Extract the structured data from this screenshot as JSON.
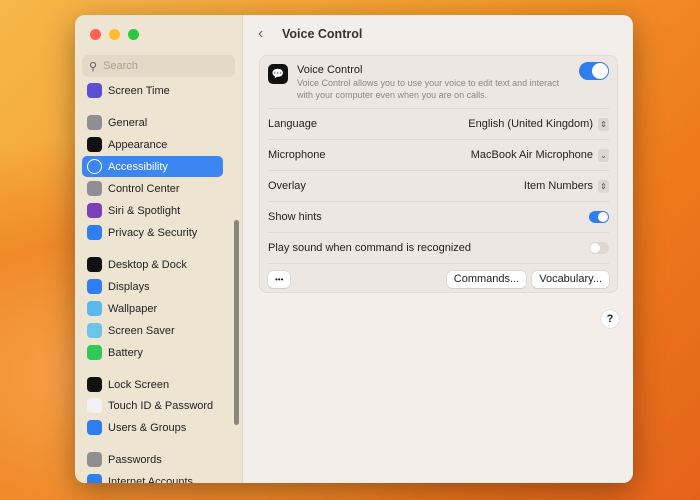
{
  "sidebar": {
    "search_placeholder": "Search",
    "items": [
      {
        "label": "Screen Time",
        "color": "#5b4fd6"
      },
      {
        "label": "General",
        "color": "#8e8e93"
      },
      {
        "label": "Appearance",
        "color": "#111111"
      },
      {
        "label": "Accessibility",
        "color": "#2f7ef0",
        "selected": true
      },
      {
        "label": "Control Center",
        "color": "#8e8e93"
      },
      {
        "label": "Siri & Spotlight",
        "color": "#7b3fb8"
      },
      {
        "label": "Privacy & Security",
        "color": "#2f7ef0"
      },
      {
        "label": "Desktop & Dock",
        "color": "#111111"
      },
      {
        "label": "Displays",
        "color": "#2f7ef0"
      },
      {
        "label": "Wallpaper",
        "color": "#5ab8ec"
      },
      {
        "label": "Screen Saver",
        "color": "#6cc4ea"
      },
      {
        "label": "Battery",
        "color": "#34c759"
      },
      {
        "label": "Lock Screen",
        "color": "#111111"
      },
      {
        "label": "Touch ID & Password",
        "color": "#f2f2f2"
      },
      {
        "label": "Users & Groups",
        "color": "#2f7ef0"
      },
      {
        "label": "Passwords",
        "color": "#8e8e93"
      },
      {
        "label": "Internet Accounts",
        "color": "#2f7ef0"
      }
    ]
  },
  "header": {
    "title": "Voice Control"
  },
  "voice_control": {
    "title": "Voice Control",
    "description": "Voice Control allows you to use your voice to edit text and interact with your computer even when you are on calls.",
    "enabled": true
  },
  "settings": {
    "language": {
      "label": "Language",
      "value": "English (United Kingdom)"
    },
    "microphone": {
      "label": "Microphone",
      "value": "MacBook Air Microphone"
    },
    "overlay": {
      "label": "Overlay",
      "value": "Item Numbers"
    },
    "show_hints": {
      "label": "Show hints",
      "enabled": true
    },
    "play_sound": {
      "label": "Play sound when command is recognized",
      "enabled": false
    }
  },
  "buttons": {
    "more": "•••",
    "commands": "Commands...",
    "vocabulary": "Vocabulary..."
  },
  "help": "?"
}
